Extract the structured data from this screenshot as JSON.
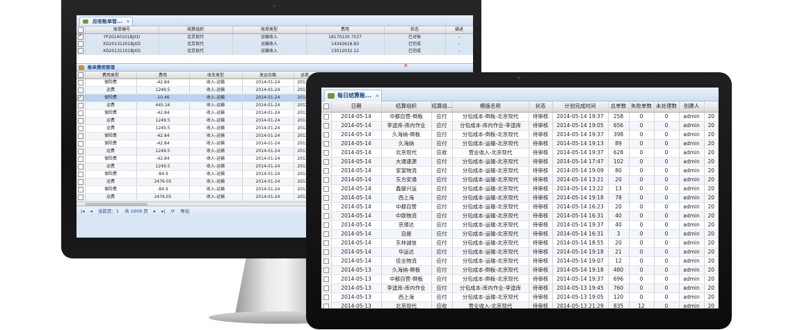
{
  "back_screen": {
    "tab_title": "应收账单管...",
    "top_grid": {
      "columns": [
        "",
        "账单编号",
        "结算组织",
        "账单类型",
        "费用",
        "状态",
        "描述"
      ],
      "rows": [
        {
          "checked": true,
          "selected": true,
          "cells": [
            "YF20140101BJXD",
            "北京现代",
            "运输收入",
            "18170130.7537",
            "已对账",
            "-"
          ]
        },
        {
          "checked": false,
          "selected": false,
          "cells": [
            "XD20131201BJXD",
            "北京现代",
            "运输收入",
            "14342618.83",
            "已完成",
            "-"
          ]
        },
        {
          "checked": false,
          "selected": false,
          "cells": [
            "XD20131101BJXD",
            "北京现代",
            "运输收入",
            "13012032.12",
            "已完成",
            "-"
          ]
        }
      ]
    },
    "detail_panel_title": "账单费用管理",
    "detail_grid": {
      "columns": [
        "",
        "费用类型",
        "费用",
        "收支类型",
        "发运日期",
        "运单"
      ],
      "rows": [
        {
          "checked": false,
          "selected": false,
          "cells": [
            "保险费",
            "-42.84",
            "收入-运输",
            "2014-01-24",
            "2013-1"
          ]
        },
        {
          "checked": false,
          "selected": false,
          "cells": [
            "运费",
            "1249.5",
            "收入-运输",
            "2014-01-24",
            "2013-1"
          ]
        },
        {
          "checked": true,
          "selected": true,
          "cells": [
            "保险费",
            "-10.46",
            "收入-运输",
            "2014-01-24",
            "2014-0"
          ]
        },
        {
          "checked": false,
          "selected": false,
          "cells": [
            "运费",
            "445.16",
            "收入-运输",
            "2014-01-24",
            "2013-1"
          ]
        },
        {
          "checked": false,
          "selected": false,
          "cells": [
            "保险费",
            "-42.84",
            "收入-运输",
            "2014-01-24",
            "2013-1"
          ]
        },
        {
          "checked": false,
          "selected": false,
          "cells": [
            "运费",
            "1249.5",
            "收入-运输",
            "2014-01-24",
            "2013-1"
          ]
        },
        {
          "checked": false,
          "selected": false,
          "cells": [
            "运费",
            "1249.5",
            "收入-运输",
            "2014-01-24",
            "2013-1"
          ]
        },
        {
          "checked": false,
          "selected": false,
          "cells": [
            "保险费",
            "-42.84",
            "收入-运输",
            "2014-01-24",
            "2013-1"
          ]
        },
        {
          "checked": false,
          "selected": false,
          "cells": [
            "保险费",
            "-42.84",
            "收入-运输",
            "2014-01-24",
            "2013-1"
          ]
        },
        {
          "checked": false,
          "selected": false,
          "cells": [
            "运费",
            "1249.5",
            "收入-运输",
            "2014-01-24",
            "2013-1"
          ]
        },
        {
          "checked": false,
          "selected": false,
          "cells": [
            "保险费",
            "-42.84",
            "收入-运输",
            "2014-01-24",
            "2013-1"
          ]
        },
        {
          "checked": false,
          "selected": false,
          "cells": [
            "运费",
            "1249.5",
            "收入-运输",
            "2014-01-24",
            "2013-1"
          ]
        },
        {
          "checked": false,
          "selected": false,
          "cells": [
            "保险费",
            "-84.9",
            "收入-运输",
            "2014-01-24",
            "2013-1"
          ]
        },
        {
          "checked": false,
          "selected": false,
          "cells": [
            "运费",
            "2476.05",
            "收入-运输",
            "2014-01-24",
            "2013-1"
          ]
        },
        {
          "checked": false,
          "selected": false,
          "cells": [
            "保险费",
            "-84.9",
            "收入-运输",
            "2014-01-24",
            "2013-1"
          ]
        },
        {
          "checked": false,
          "selected": false,
          "cells": [
            "运费",
            "2476.05",
            "收入-运输",
            "2014-01-24",
            "2013-1"
          ]
        }
      ]
    },
    "pager": {
      "current_label": "当前页：1",
      "total_label": "共 1606 页",
      "export_label": "导出"
    }
  },
  "front_screen": {
    "tab_title": "每日结算账...",
    "grid": {
      "columns": [
        "",
        "日期",
        "结算组织",
        "结算组...",
        "模版名称",
        "状态",
        "计划完成时间",
        "总单数",
        "失败单数",
        "未处理数",
        "创建人",
        ""
      ],
      "rows": [
        [
          "2014-05-14",
          "中都自营-倒板",
          "应付",
          "分包成本-倒板-北京现代",
          "待审核",
          "2014-05-14 19:37",
          "258",
          "0",
          "0",
          "admin",
          "20"
        ],
        [
          "2014-05-14",
          "李逵库-库内作业",
          "应付",
          "分包成本-库内作业-李逵库",
          "待审核",
          "2014-05-14 19:05",
          "656",
          "0",
          "0",
          "admin",
          "20"
        ],
        [
          "2014-05-14",
          "久海纳-倒板",
          "应付",
          "分包成本-倒板-北京现代",
          "待审核",
          "2014-05-14 19:37",
          "398",
          "0",
          "0",
          "admin",
          "20"
        ],
        [
          "2014-05-14",
          "久海纳",
          "应付",
          "分包成本-运输-北京现代",
          "待审核",
          "2014-05-14 19:13",
          "89",
          "0",
          "0",
          "admin",
          "20"
        ],
        [
          "2014-05-14",
          "北京现代",
          "应收",
          "营业收入-北京现代",
          "待审核",
          "2014-05-14 19:37",
          "628",
          "0",
          "0",
          "admin",
          "20"
        ],
        [
          "2014-05-14",
          "大通速源",
          "应付",
          "分包成本-运输-北京现代",
          "待审核",
          "2014-05-14 17:47",
          "102",
          "0",
          "0",
          "admin",
          "20"
        ],
        [
          "2014-05-14",
          "安富物流",
          "应付",
          "分包成本-运输-北京现代",
          "待审核",
          "2014-05-14 19:09",
          "80",
          "0",
          "0",
          "admin",
          "20"
        ],
        [
          "2014-05-14",
          "东方安通",
          "应付",
          "分包成本-运输-北京现代",
          "待审核",
          "2014-05-14 13:21",
          "20",
          "0",
          "0",
          "admin",
          "20"
        ],
        [
          "2014-05-14",
          "鑫骏兴运",
          "应付",
          "分包成本-运输-北京现代",
          "待审核",
          "2014-05-14 13:22",
          "13",
          "0",
          "0",
          "admin",
          "20"
        ],
        [
          "2014-05-14",
          "西上海",
          "应付",
          "分包成本-运输-北京现代",
          "待审核",
          "2014-05-14 19:18",
          "78",
          "0",
          "0",
          "admin",
          "20"
        ],
        [
          "2014-05-14",
          "中都自营",
          "应付",
          "分包成本-运输-北京现代",
          "待审核",
          "2014-05-14 16:23",
          "20",
          "0",
          "0",
          "admin",
          "20"
        ],
        [
          "2014-05-14",
          "中联物流",
          "应付",
          "分包成本-运输-北京现代",
          "待审核",
          "2014-05-14 16:31",
          "40",
          "0",
          "0",
          "admin",
          "20"
        ],
        [
          "2014-05-14",
          "京顺达",
          "应付",
          "分包成本-运输-北京现代",
          "待审核",
          "2014-05-14 19:37",
          "40",
          "0",
          "0",
          "admin",
          "20"
        ],
        [
          "2014-05-14",
          "自提",
          "应付",
          "分包成本-运输-北京现代",
          "待审核",
          "2014-05-14 16:31",
          "3",
          "0",
          "0",
          "admin",
          "20"
        ],
        [
          "2014-05-14",
          "东林诚信",
          "应付",
          "分包成本-运输-北京现代",
          "待审核",
          "2014-05-14 18:55",
          "20",
          "0",
          "0",
          "admin",
          "20"
        ],
        [
          "2014-05-14",
          "华运达",
          "应付",
          "分包成本-运输-北京现代",
          "待审核",
          "2014-05-14 19:18",
          "21",
          "0",
          "0",
          "admin",
          "20"
        ],
        [
          "2014-05-14",
          "佳业物流",
          "应付",
          "分包成本-运输-北京现代",
          "待审核",
          "2014-05-14 19:07",
          "12",
          "0",
          "0",
          "admin",
          "20"
        ],
        [
          "2014-05-13",
          "久海纳-倒板",
          "应付",
          "分包成本-倒板-北京现代",
          "待审核",
          "2014-05-14 19:18",
          "480",
          "0",
          "0",
          "admin",
          "20"
        ],
        [
          "2014-05-13",
          "中都自营-倒板",
          "应付",
          "分包成本-倒板-北京现代",
          "待审核",
          "2014-05-14 19:37",
          "696",
          "0",
          "0",
          "admin",
          "20"
        ],
        [
          "2014-05-13",
          "李逵库-库内作业",
          "应付",
          "分包成本-库内作业-李逵库",
          "待审核",
          "2014-05-13 19:45",
          "760",
          "0",
          "0",
          "admin",
          "20"
        ],
        [
          "2014-05-13",
          "西上海",
          "应付",
          "分包成本-运输-北京现代",
          "待审核",
          "2014-05-13 19:05",
          "120",
          "0",
          "0",
          "admin",
          "20"
        ],
        [
          "2014-05-13",
          "北京现代",
          "应收",
          "营业收入-北京现代",
          "待审核",
          "2014-05-13 21:29",
          "835",
          "12",
          "0",
          "admin",
          "20"
        ]
      ]
    }
  },
  "colors": {
    "header_blue": "#15428b",
    "selection": "#b9d3f0",
    "bezel": "#111111"
  }
}
